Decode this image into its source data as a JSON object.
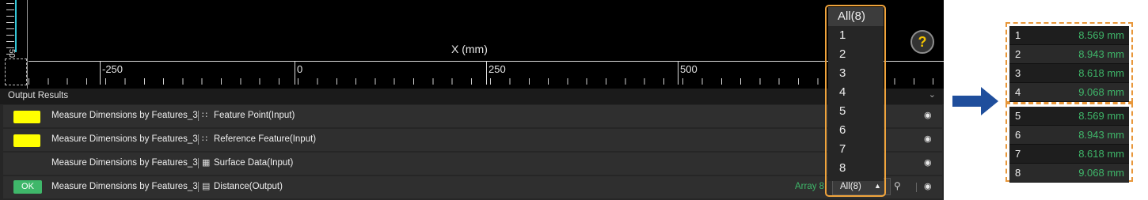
{
  "viewport": {
    "x_axis_title": "X (mm)",
    "tick_labels": [
      "-250",
      "0",
      "250",
      "500"
    ],
    "vertical_axis_label": "50",
    "help_label": "?"
  },
  "results": {
    "title": "Output Results",
    "rows": [
      {
        "name": "Measure Dimensions by Features_3",
        "item": "Feature Point(Input)",
        "icon": "feature-point-icon",
        "swatch_color": "#ffff00"
      },
      {
        "name": "Measure Dimensions by Features_3",
        "item": "Reference Feature(Input)",
        "icon": "reference-feature-icon",
        "swatch_color": "#ffff00"
      },
      {
        "name": "Measure Dimensions by Features_3",
        "item": "Surface Data(Input)",
        "icon": "surface-data-icon"
      },
      {
        "name": "Measure Dimensions by Features_3",
        "item": "Distance(Output)",
        "icon": "distance-icon",
        "status": "OK",
        "array_label": "Array 8",
        "selected": "All(8)"
      }
    ]
  },
  "dropdown": {
    "options": [
      "All(8)",
      "1",
      "2",
      "3",
      "4",
      "5",
      "6",
      "7",
      "8"
    ]
  },
  "value_panels": {
    "top": [
      {
        "index": "1",
        "value": "8.569 mm"
      },
      {
        "index": "2",
        "value": "8.943 mm"
      },
      {
        "index": "3",
        "value": "8.618 mm"
      },
      {
        "index": "4",
        "value": "9.068 mm"
      }
    ],
    "bottom": [
      {
        "index": "5",
        "value": "8.569 mm"
      },
      {
        "index": "6",
        "value": "8.943 mm"
      },
      {
        "index": "7",
        "value": "8.618 mm"
      },
      {
        "index": "8",
        "value": "9.068 mm"
      }
    ]
  },
  "colors": {
    "ok_green": "#3fb76a",
    "highlight_orange": "#f0a43c",
    "arrow_blue": "#1f4e9c",
    "swatch_yellow": "#ffff00"
  }
}
